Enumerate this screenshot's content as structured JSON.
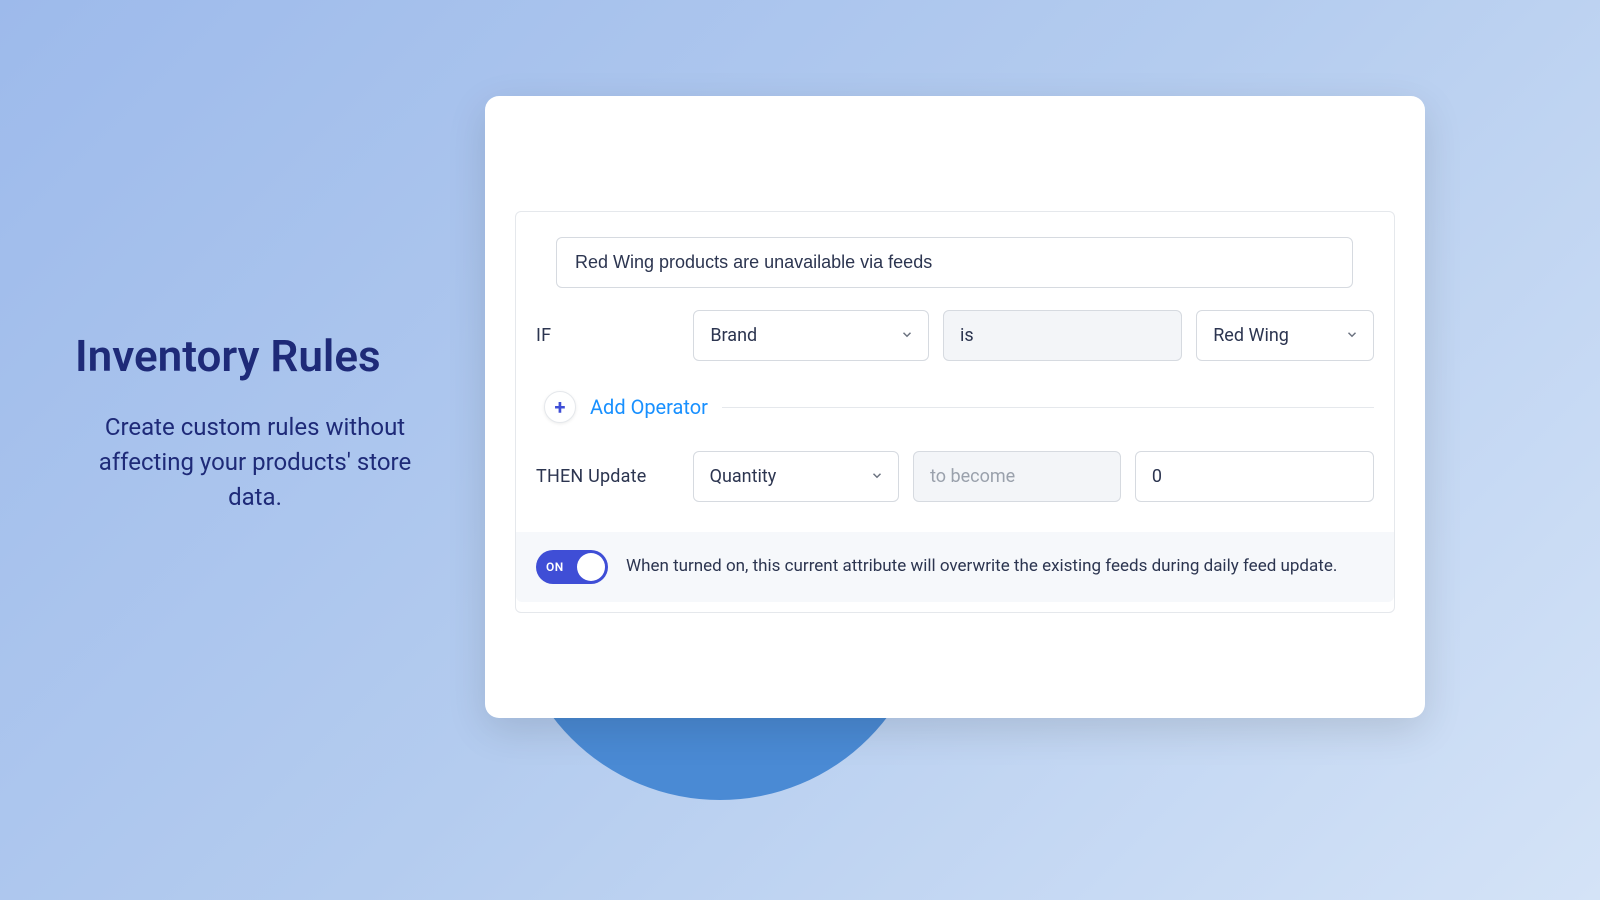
{
  "left": {
    "heading": "Inventory Rules",
    "subtitle": "Create custom rules without affecting your products' store data."
  },
  "rule": {
    "name": "Red Wing products are unavailable via feeds",
    "if_label": "IF",
    "if_attribute": "Brand",
    "if_operator": "is",
    "if_value": "Red Wing",
    "add_operator": "Add Operator",
    "then_label": "THEN Update",
    "then_attribute": "Quantity",
    "then_action_placeholder": "to become",
    "then_value": "0",
    "toggle_state": "ON",
    "toggle_description": "When turned on, this current attribute will overwrite the existing feeds during daily feed update."
  }
}
